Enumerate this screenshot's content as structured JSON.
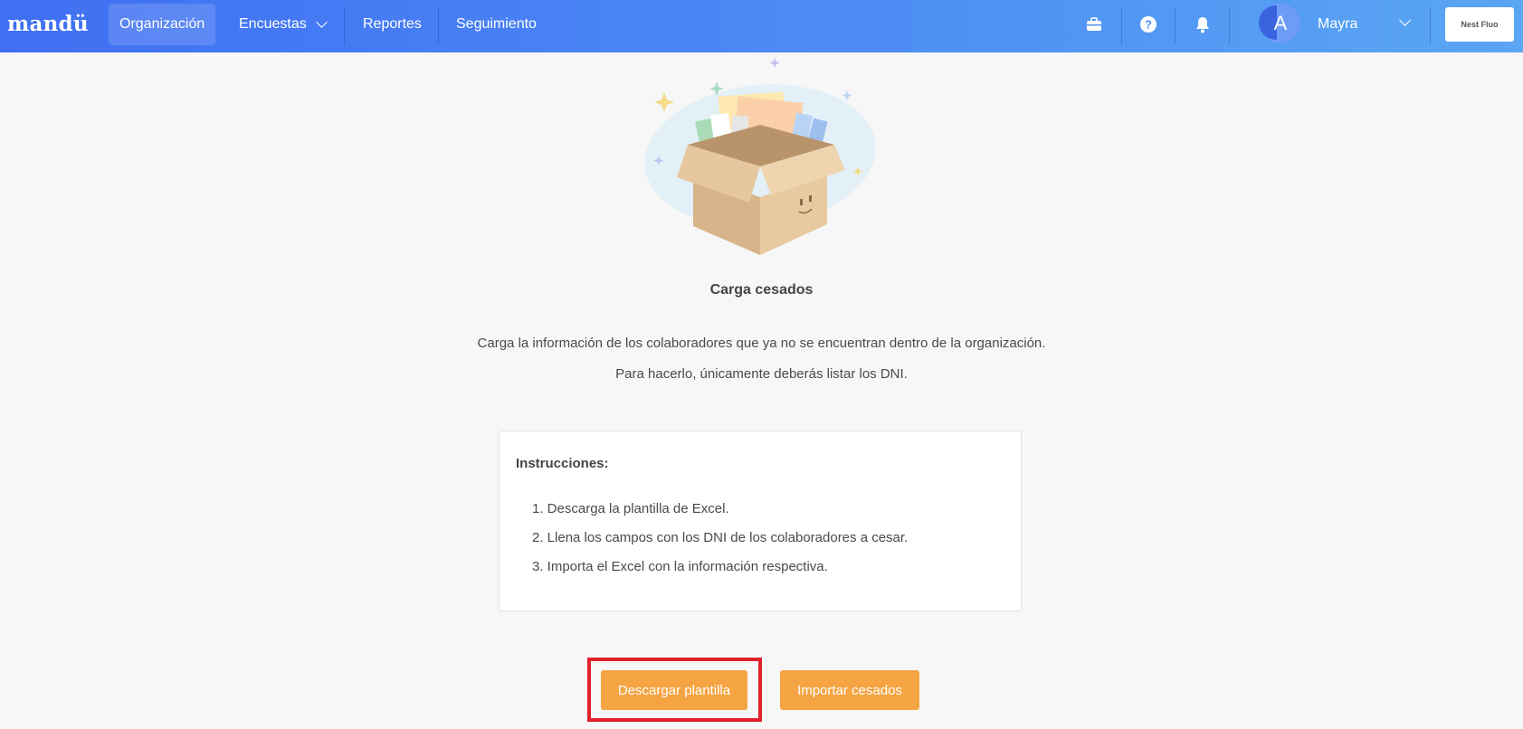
{
  "brand": "mandü",
  "nav": {
    "items": [
      {
        "label": "Organización",
        "active": true
      },
      {
        "label": "Encuestas",
        "has_dropdown": true
      },
      {
        "label": "Reportes"
      },
      {
        "label": "Seguimiento"
      }
    ]
  },
  "header_icons": [
    "briefcase-icon",
    "help-icon",
    "bell-icon"
  ],
  "user": {
    "avatar_initial": "A",
    "name": "Mayra"
  },
  "org_logo_text": "Nest Fluo",
  "main": {
    "title": "Carga cesados",
    "description_line1": "Carga la información de los colaboradores que ya no se encuentran dentro de la organización.",
    "description_line2": "Para hacerlo, únicamente deberás listar los DNI."
  },
  "instructions": {
    "heading": "Instrucciones:",
    "steps": [
      "1. Descarga la plantilla de Excel.",
      "2. Llena los campos con los DNI de los colaboradores a cesar.",
      "3. Importa el Excel con la información respectiva."
    ]
  },
  "actions": {
    "download_label": "Descargar plantilla",
    "import_label": "Importar cesados"
  },
  "colors": {
    "nav_gradient_start": "#3f6ff2",
    "nav_gradient_end": "#5aa6f3",
    "button": "#f5a443",
    "highlight": "#e0202a"
  }
}
